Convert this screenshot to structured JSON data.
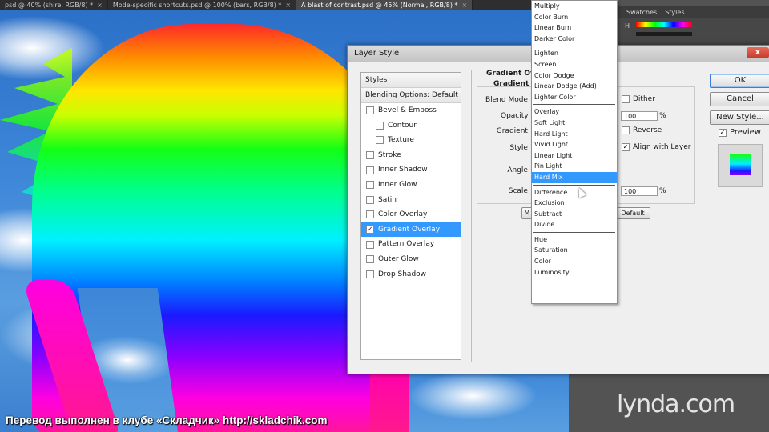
{
  "doc_tabs": [
    {
      "label": "psd @ 40% (shire, RGB/8) *",
      "close": "×"
    },
    {
      "label": "Mode-specific shortcuts.psd @ 100% (bars, RGB/8) *",
      "close": "×"
    },
    {
      "label": "A blast of contrast.psd @ 45% (Normal, RGB/8) *",
      "close": "×"
    }
  ],
  "right_panel": {
    "swatches_tab": "Swatches",
    "styles_tab": "Styles",
    "h_label": "H"
  },
  "dialog": {
    "title": "Layer Style",
    "close": "x",
    "styles_header": "Styles",
    "blending_options": "Blending Options: Default",
    "style_items": [
      {
        "label": "Bevel & Emboss",
        "checked": "",
        "sub": false,
        "selected": false
      },
      {
        "label": "Contour",
        "checked": "",
        "sub": true,
        "selected": false
      },
      {
        "label": "Texture",
        "checked": "",
        "sub": true,
        "selected": false
      },
      {
        "label": "Stroke",
        "checked": "",
        "sub": false,
        "selected": false
      },
      {
        "label": "Inner Shadow",
        "checked": "",
        "sub": false,
        "selected": false
      },
      {
        "label": "Inner Glow",
        "checked": "",
        "sub": false,
        "selected": false
      },
      {
        "label": "Satin",
        "checked": "",
        "sub": false,
        "selected": false
      },
      {
        "label": "Color Overlay",
        "checked": "",
        "sub": false,
        "selected": false
      },
      {
        "label": "Gradient Overlay",
        "checked": "✓",
        "sub": false,
        "selected": true
      },
      {
        "label": "Pattern Overlay",
        "checked": "",
        "sub": false,
        "selected": false
      },
      {
        "label": "Outer Glow",
        "checked": "",
        "sub": false,
        "selected": false
      },
      {
        "label": "Drop Shadow",
        "checked": "",
        "sub": false,
        "selected": false
      }
    ],
    "group_title": "Gradient Ove",
    "group_subtitle": "Gradient",
    "labels": {
      "blend_mode": "Blend Mode:",
      "opacity": "Opacity:",
      "gradient": "Gradient:",
      "style": "Style:",
      "angle": "Angle:",
      "scale": "Scale:"
    },
    "opacity_value": "100",
    "scale_value": "100",
    "percent": "%",
    "checkboxes": {
      "dither": {
        "label": "Dither",
        "checked": ""
      },
      "reverse": {
        "label": "Reverse",
        "checked": ""
      },
      "align": {
        "label": "Align with Layer",
        "checked": "✓"
      }
    },
    "make_default_partial": "M",
    "reset_default_partial": "Default",
    "buttons": {
      "ok": "OK",
      "cancel": "Cancel",
      "new_style": "New Style..."
    },
    "preview": {
      "label": "Preview",
      "checked": "✓"
    }
  },
  "blend_menu": {
    "groups": [
      [
        "Multiply",
        "Color Burn",
        "Linear Burn",
        "Darker Color"
      ],
      [
        "Lighten",
        "Screen",
        "Color Dodge",
        "Linear Dodge (Add)",
        "Lighter Color"
      ],
      [
        "Overlay",
        "Soft Light",
        "Hard Light",
        "Vivid Light",
        "Linear Light",
        "Pin Light",
        "Hard Mix"
      ],
      [
        "Difference",
        "Exclusion",
        "Subtract",
        "Divide"
      ],
      [
        "Hue",
        "Saturation",
        "Color",
        "Luminosity"
      ]
    ],
    "highlighted": "Hard Mix"
  },
  "watermark": "lynda.com",
  "caption": "Перевод выполнен в клубе «Складчик» http://skladchik.com",
  "colors": {
    "selection": "#3399ff",
    "dialog_bg": "#efefef",
    "panel_bg": "#535353"
  }
}
